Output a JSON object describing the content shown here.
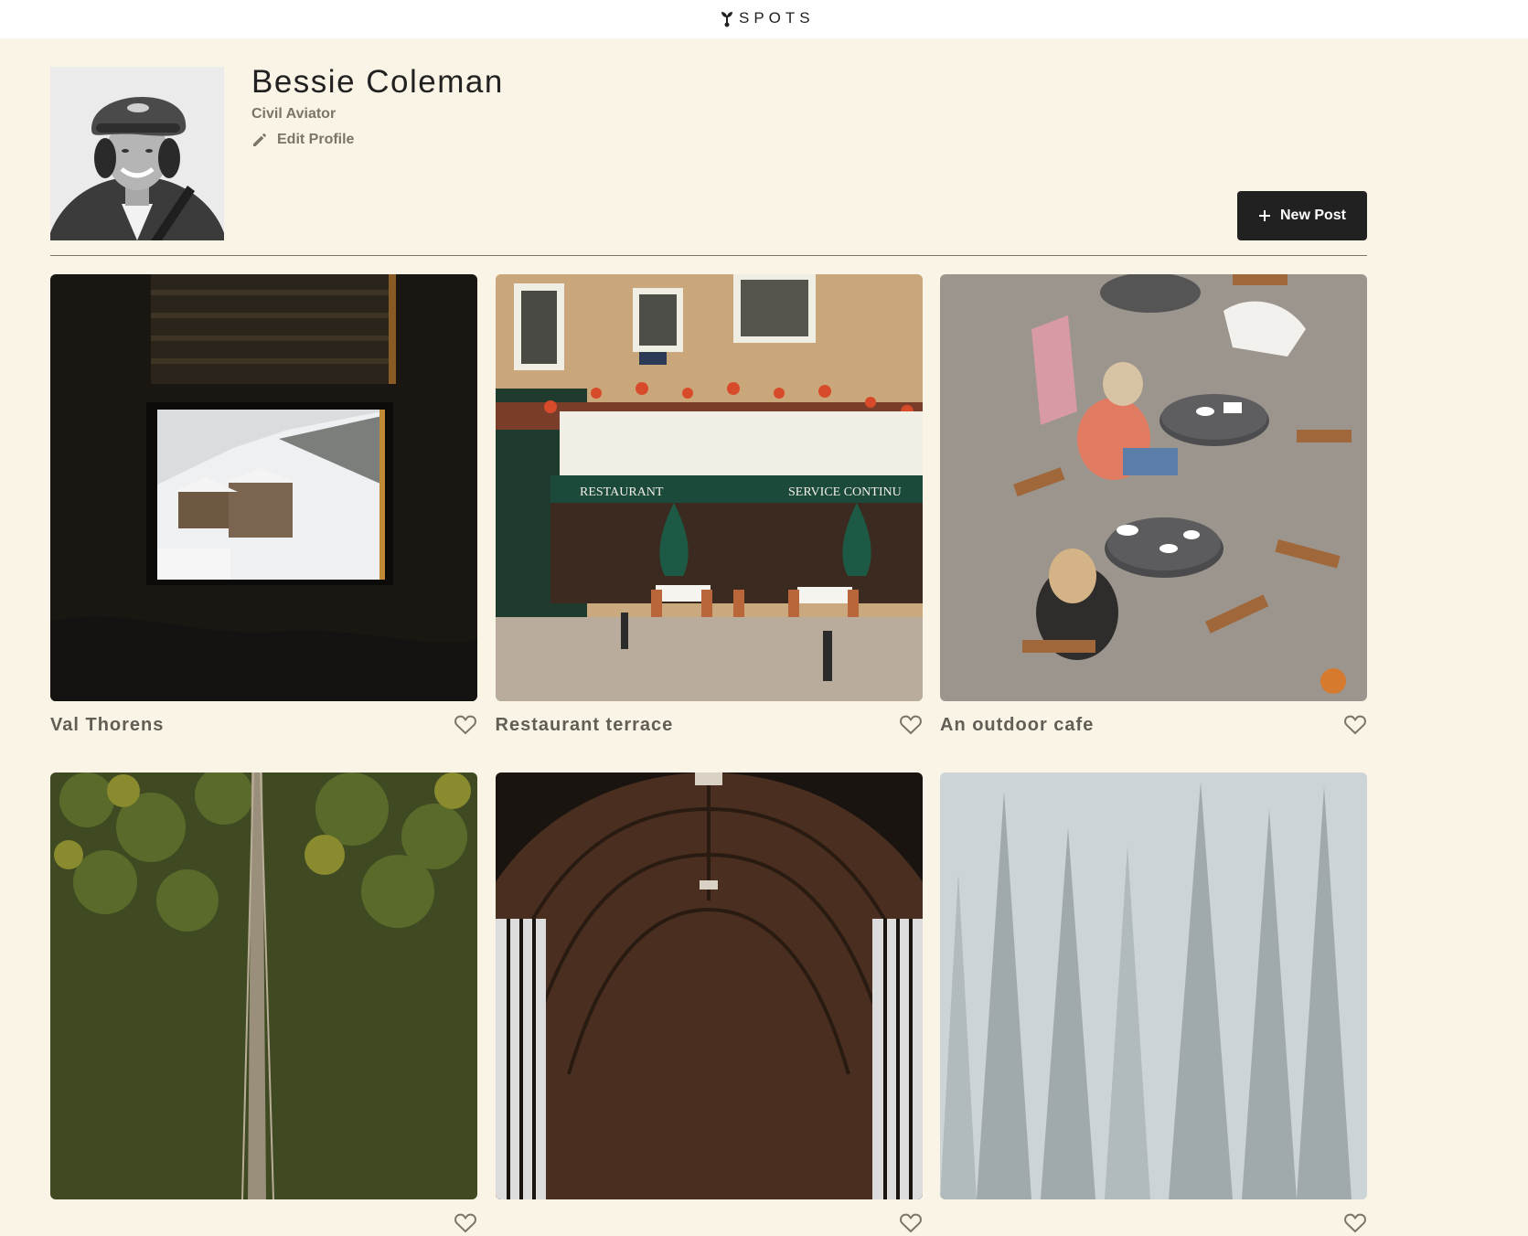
{
  "header": {
    "logo_text": "SPOTS",
    "logo_icon": "sprout-icon"
  },
  "profile": {
    "name": "Bessie Coleman",
    "description": "Civil Aviator",
    "edit_label": "Edit Profile",
    "avatar_alt": "Bessie Coleman"
  },
  "actions": {
    "new_post_label": "New Post"
  },
  "cards": [
    {
      "title": "Val Thorens",
      "liked": false
    },
    {
      "title": "Restaurant terrace",
      "liked": false
    },
    {
      "title": "An outdoor cafe",
      "liked": false
    },
    {
      "title": "",
      "liked": false
    },
    {
      "title": "",
      "liked": false
    },
    {
      "title": "",
      "liked": false
    }
  ],
  "colors": {
    "page_background": "#f9f4e5",
    "header_background": "#ffffff",
    "primary_text": "#212121",
    "secondary_text": "#7a7667",
    "button_background": "#212121",
    "button_text": "#ffffff"
  }
}
